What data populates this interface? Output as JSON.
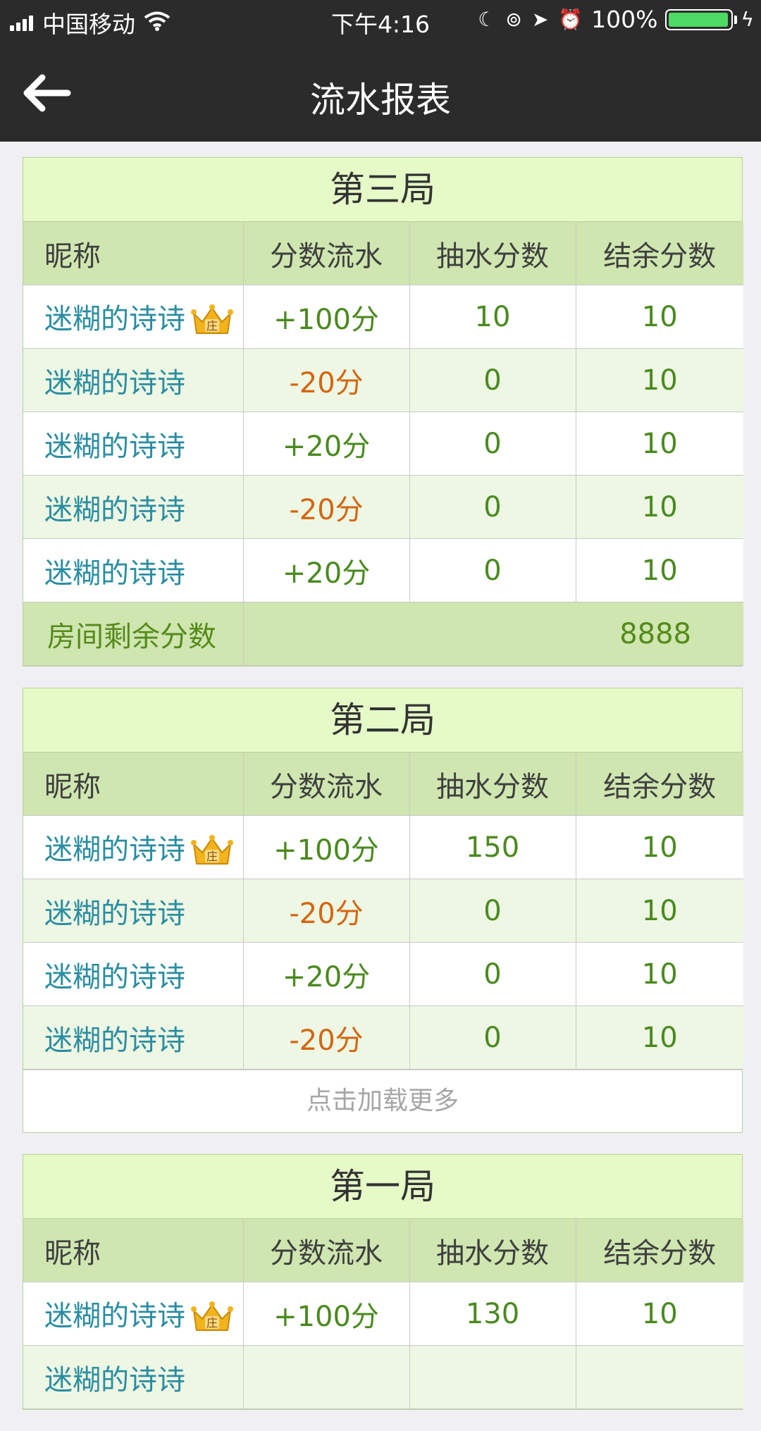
{
  "status_bar": {
    "carrier": "中国移动",
    "time": "下午4:16",
    "battery_percent": "100%",
    "icons": [
      "signal-icon",
      "wifi-icon",
      "moon-icon",
      "orientation-lock-icon",
      "location-icon",
      "alarm-icon",
      "battery-icon",
      "charging-icon"
    ]
  },
  "header": {
    "title": "流水报表",
    "back_icon": "back-arrow-icon"
  },
  "columns": [
    "昵称",
    "分数流水",
    "抽水分数",
    "结余分数"
  ],
  "rounds": [
    {
      "title": "第三局",
      "rows": [
        {
          "name": "迷糊的诗诗",
          "dealer": true,
          "flow": "+100分",
          "rake": "10",
          "balance": "10",
          "sign": "pos"
        },
        {
          "name": "迷糊的诗诗",
          "dealer": false,
          "flow": "-20分",
          "rake": "0",
          "balance": "10",
          "sign": "neg"
        },
        {
          "name": "迷糊的诗诗",
          "dealer": false,
          "flow": "+20分",
          "rake": "0",
          "balance": "10",
          "sign": "pos"
        },
        {
          "name": "迷糊的诗诗",
          "dealer": false,
          "flow": "-20分",
          "rake": "0",
          "balance": "10",
          "sign": "neg"
        },
        {
          "name": "迷糊的诗诗",
          "dealer": false,
          "flow": "+20分",
          "rake": "0",
          "balance": "10",
          "sign": "pos"
        }
      ],
      "summary": {
        "label": "房间剩余分数",
        "value": "8888"
      }
    },
    {
      "title": "第二局",
      "rows": [
        {
          "name": "迷糊的诗诗",
          "dealer": true,
          "flow": "+100分",
          "rake": "150",
          "balance": "10",
          "sign": "pos"
        },
        {
          "name": "迷糊的诗诗",
          "dealer": false,
          "flow": "-20分",
          "rake": "0",
          "balance": "10",
          "sign": "neg"
        },
        {
          "name": "迷糊的诗诗",
          "dealer": false,
          "flow": "+20分",
          "rake": "0",
          "balance": "10",
          "sign": "pos"
        },
        {
          "name": "迷糊的诗诗",
          "dealer": false,
          "flow": "-20分",
          "rake": "0",
          "balance": "10",
          "sign": "neg"
        }
      ],
      "load_more": "点击加载更多"
    },
    {
      "title": "第一局",
      "rows": [
        {
          "name": "迷糊的诗诗",
          "dealer": true,
          "flow": "+100分",
          "rake": "130",
          "balance": "10",
          "sign": "pos"
        },
        {
          "name": "迷糊的诗诗",
          "dealer": false,
          "flow": "",
          "rake": "",
          "balance": "",
          "sign": "pos"
        }
      ]
    }
  ],
  "dealer_badge": {
    "text": "庄",
    "icon": "crown-icon",
    "color": "#f2b31c"
  }
}
